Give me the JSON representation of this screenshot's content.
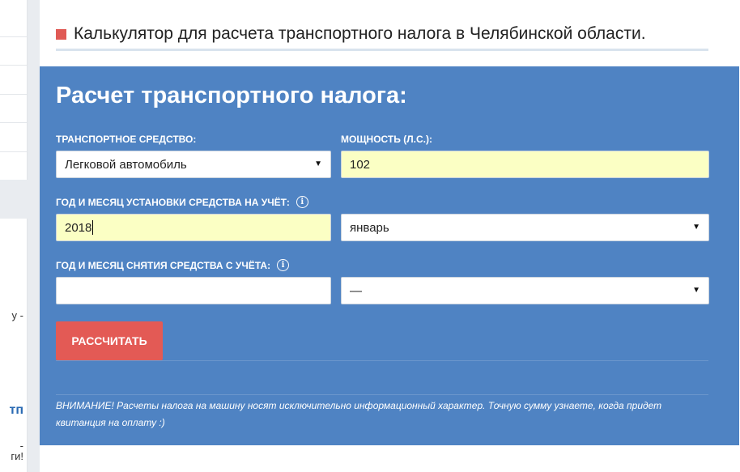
{
  "sidebar": {
    "fragments": [
      "у -",
      "тп",
      "-",
      "ги!"
    ]
  },
  "page": {
    "heading": "Калькулятор для расчета транспортного налога в Челябинской области."
  },
  "calculator": {
    "title": "Расчет транспортного налога:",
    "vehicle": {
      "label": "ТРАНСПОРТНОЕ СРЕДСТВО:",
      "value": "Легковой автомобиль"
    },
    "power": {
      "label": "МОЩНОСТЬ (Л.С.):",
      "value": "102"
    },
    "registration": {
      "label": "ГОД И МЕСЯЦ УСТАНОВКИ СРЕДСТВА НА УЧЁТ:",
      "year": "2018",
      "month": "январь"
    },
    "deregistration": {
      "label": "ГОД И МЕСЯЦ СНЯТИЯ СРЕДСТВА С УЧЁТА:",
      "year": "",
      "month": "—"
    },
    "submit_label": "РАССЧИТАТЬ",
    "notice": "ВНИМАНИЕ! Расчеты налога на машину носят исключительно информационный характер. Точную сумму узнаете, когда придет квитанция на оплату :)"
  },
  "colors": {
    "calc_background": "#4f83c3",
    "button": "#e35a55",
    "highlight_field": "#fbffc4",
    "heading_marker": "#e05a55"
  }
}
